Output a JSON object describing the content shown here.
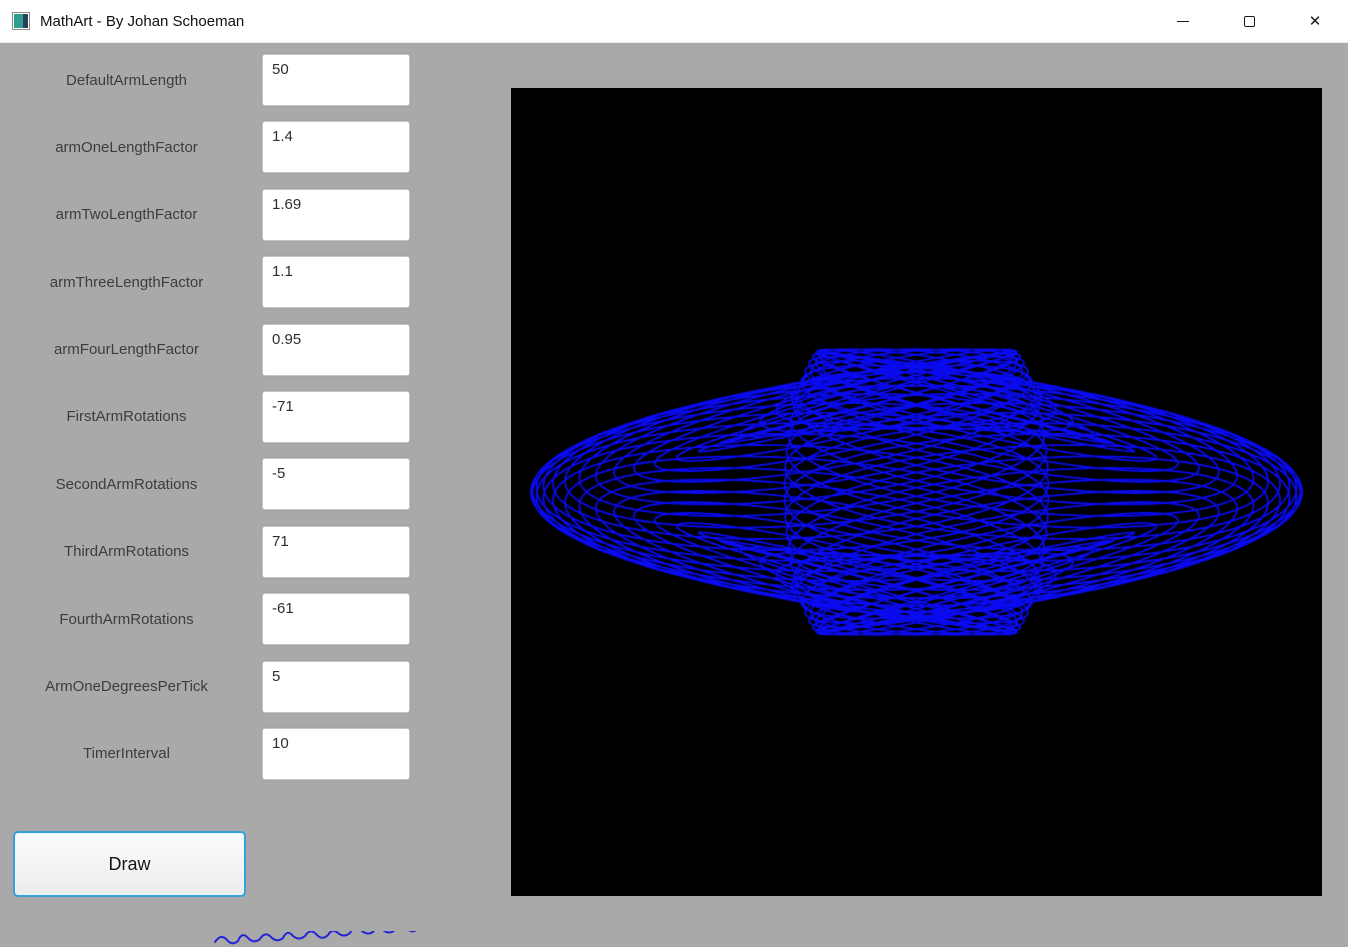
{
  "window": {
    "title": "MathArt - By Johan Schoeman",
    "icons": {
      "minimize": "─",
      "maximize": "□",
      "close": "✕"
    }
  },
  "form": {
    "fields": [
      {
        "label": "DefaultArmLength",
        "value": "50"
      },
      {
        "label": "armOneLengthFactor",
        "value": "1.4"
      },
      {
        "label": "armTwoLengthFactor",
        "value": "1.69"
      },
      {
        "label": "armThreeLengthFactor",
        "value": "1.1"
      },
      {
        "label": "armFourLengthFactor",
        "value": "0.95"
      },
      {
        "label": "FirstArmRotations",
        "value": "-71"
      },
      {
        "label": "SecondArmRotations",
        "value": "-5"
      },
      {
        "label": "ThirdArmRotations",
        "value": "71"
      },
      {
        "label": "FourthArmRotations",
        "value": "-61"
      },
      {
        "label": "ArmOneDegreesPerTick",
        "value": "5"
      },
      {
        "label": "TimerInterval",
        "value": "10"
      }
    ],
    "draw_button_label": "Draw"
  },
  "canvas": {
    "background": "#000000",
    "stroke_color": "#0a0af0"
  }
}
